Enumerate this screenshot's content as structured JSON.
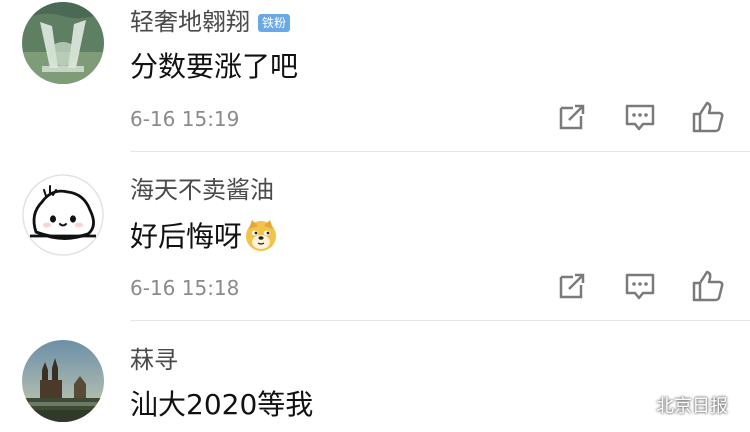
{
  "comments": [
    {
      "username": "轻奢地翱翔",
      "badge": "铁粉",
      "text": "分数要涨了吧",
      "time": "6-16 15:19",
      "avatar": "green-landscape-photo-avatar"
    },
    {
      "username": "海天不卖酱油",
      "text": "好后悔呀",
      "emoji": "doge-emoji",
      "time": "6-16 15:18",
      "avatar": "cartoon-cloud-face-avatar"
    },
    {
      "username": "菻寻",
      "text": "汕大2020等我",
      "avatar": "cathedral-photo-avatar"
    }
  ],
  "actions": {
    "share_icon": "share-icon",
    "reply_icon": "comment-icon",
    "like_icon": "thumbs-up-icon"
  },
  "watermark": {
    "text": "北京日报",
    "icon": "wechat-icon"
  },
  "colors": {
    "username": "#4a4a4a",
    "content": "#111111",
    "time": "#8a8a8a",
    "badge_bg": "#6aa8e8",
    "icon": "#7a7a7a",
    "divider": "#e6e6e6"
  }
}
